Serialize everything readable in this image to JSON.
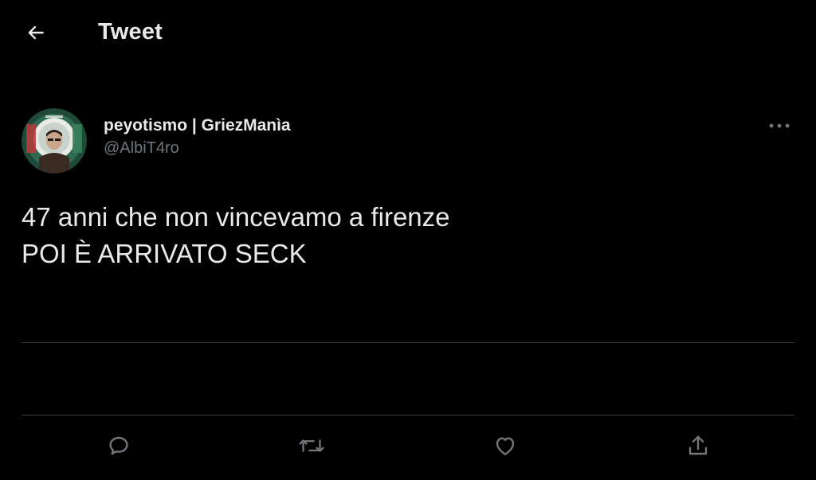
{
  "header": {
    "title": "Tweet",
    "back_icon": "arrow-left-icon"
  },
  "tweet": {
    "author": {
      "display_name": "peyotismo | GriezManìa",
      "handle": "@AlbiT4ro",
      "avatar": "profile-photo"
    },
    "text_lines": [
      "47 anni che non vincevamo a firenze",
      "POI È ARRIVATO SECK"
    ],
    "more_icon": "more-horizontal-icon"
  },
  "actions": [
    {
      "icon": "reply-icon"
    },
    {
      "icon": "retweet-icon"
    },
    {
      "icon": "like-icon"
    },
    {
      "icon": "share-icon"
    }
  ],
  "colors": {
    "background": "#000000",
    "text_primary": "#e7e9ea",
    "text_secondary": "#71767b",
    "divider": "#3a3d41"
  }
}
